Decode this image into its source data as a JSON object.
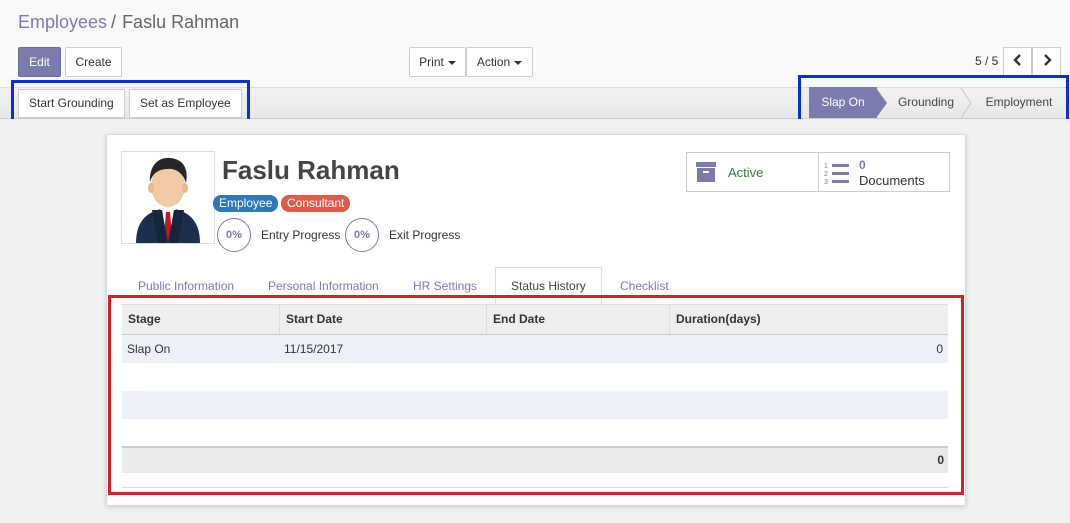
{
  "breadcrumb": {
    "parent": "Employees",
    "separator": "/",
    "current": "Faslu Rahman"
  },
  "toolbar": {
    "edit_label": "Edit",
    "create_label": "Create",
    "print_label": "Print",
    "action_label": "Action"
  },
  "pager": {
    "text": "5 / 5"
  },
  "header_buttons": {
    "start_grounding": "Start Grounding",
    "set_as_employee": "Set as Employee"
  },
  "stages": {
    "items": [
      {
        "label": "Slap On",
        "active": true
      },
      {
        "label": "Grounding",
        "active": false
      },
      {
        "label": "Employment",
        "active": false
      }
    ]
  },
  "employee": {
    "name": "Faslu Rahman"
  },
  "tags": [
    {
      "label": "Employee",
      "color": "#2e7ab8"
    },
    {
      "label": "Consultant",
      "color": "#e05a4b"
    }
  ],
  "progress": {
    "entry": {
      "value": "0%",
      "label": "Entry Progress"
    },
    "exit": {
      "value": "0%",
      "label": "Exit Progress"
    }
  },
  "smart_buttons": {
    "active_label": "Active",
    "documents_count": "0",
    "documents_label": "Documents"
  },
  "tabs": [
    {
      "label": "Public Information"
    },
    {
      "label": "Personal Information"
    },
    {
      "label": "HR Settings"
    },
    {
      "label": "Status History"
    },
    {
      "label": "Checklist"
    }
  ],
  "status_history": {
    "columns": [
      "Stage",
      "Start Date",
      "End Date",
      "Duration(days)"
    ],
    "rows": [
      {
        "stage": "Slap On",
        "start_date": "11/15/2017",
        "end_date": "",
        "duration": "0"
      }
    ],
    "total": "0"
  },
  "colors": {
    "accent": "#7c7bad",
    "active_green": "#3c763d",
    "highlight_blue": "#0a2fd8",
    "highlight_red": "#d81f26"
  }
}
